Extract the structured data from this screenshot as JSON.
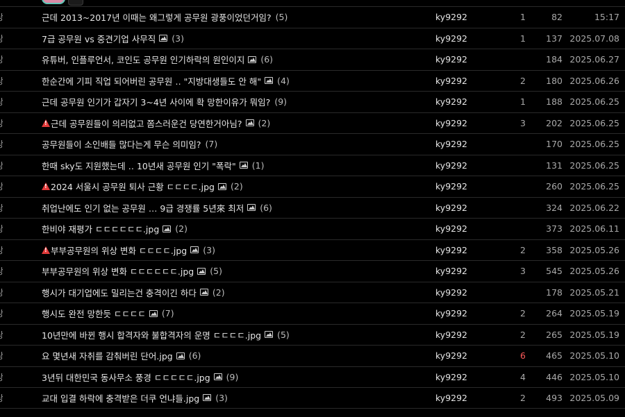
{
  "rows": [
    {
      "lead": "상",
      "title": "근데 2013~2017년 이때는 왜그렇게 공무원 광풍이었던거임?",
      "warn": false,
      "img": false,
      "count": "(5)",
      "author": "ky9292",
      "rec": "1",
      "views": "82",
      "date": "15:17"
    },
    {
      "lead": "상",
      "title": "7급 공무원 vs 중견기업 사무직",
      "warn": false,
      "img": true,
      "count": "(3)",
      "author": "ky9292",
      "rec": "1",
      "views": "137",
      "date": "2025.07.08"
    },
    {
      "lead": "상",
      "title": "유튜버, 인플루언서, 코인도 공무원 인기하락의 원인이지",
      "warn": false,
      "img": true,
      "count": "(6)",
      "author": "ky9292",
      "rec": "",
      "views": "184",
      "date": "2025.06.27"
    },
    {
      "lead": "상",
      "title": "한순간에 기피 직업 되어버린 공무원 ‥ \"지방대생들도 안 해\"",
      "warn": false,
      "img": true,
      "count": "(4)",
      "author": "ky9292",
      "rec": "2",
      "views": "180",
      "date": "2025.06.26"
    },
    {
      "lead": "상",
      "title": "근데 공무원 인기가 갑자기 3~4년 사이에 확 망한이유가 뭐임?",
      "warn": false,
      "img": false,
      "count": "(9)",
      "author": "ky9292",
      "rec": "1",
      "views": "188",
      "date": "2025.06.25"
    },
    {
      "lead": "상",
      "title": "근데 공무원들이 의리없고 쫌스러운건 당연한거아님?",
      "warn": true,
      "img": true,
      "count": "(2)",
      "author": "ky9292",
      "rec": "3",
      "views": "202",
      "date": "2025.06.25"
    },
    {
      "lead": "상",
      "title": "공무원들이 소인배들 많다는게 무슨 의미임?",
      "warn": false,
      "img": false,
      "count": "(7)",
      "author": "ky9292",
      "rec": "",
      "views": "170",
      "date": "2025.06.25"
    },
    {
      "lead": "상",
      "title": "한때 sky도 지원했는데 ‥ 10년새 공무원 인기 \"폭락\"",
      "warn": false,
      "img": true,
      "count": "(1)",
      "author": "ky9292",
      "rec": "",
      "views": "131",
      "date": "2025.06.25"
    },
    {
      "lead": "상",
      "title": "2024 서울시 공무원 퇴사 근황 ㄷㄷㄷㄷ.jpg",
      "warn": true,
      "img": true,
      "count": "(2)",
      "author": "ky9292",
      "rec": "",
      "views": "260",
      "date": "2025.06.25"
    },
    {
      "lead": "상",
      "title": "취업난에도 인기 없는 공무원 … 9급 경쟁률 5년來 최저",
      "warn": false,
      "img": true,
      "count": "(6)",
      "author": "ky9292",
      "rec": "",
      "views": "324",
      "date": "2025.06.22"
    },
    {
      "lead": "상",
      "title": "한비야 재평가 ㄷㄷㄷㄷㄷㄷ.jpg",
      "warn": false,
      "img": true,
      "count": "(2)",
      "author": "ky9292",
      "rec": "",
      "views": "373",
      "date": "2025.06.11"
    },
    {
      "lead": "상",
      "title": "부부공무원의 위상 변화 ㄷㄷㄷㄷ.jpg",
      "warn": true,
      "img": true,
      "count": "(3)",
      "author": "ky9292",
      "rec": "2",
      "views": "358",
      "date": "2025.05.26"
    },
    {
      "lead": "상",
      "title": "부부공무원의 위상 변화 ㄷㄷㄷㄷㄷㄷ.jpg",
      "warn": false,
      "img": true,
      "count": "(5)",
      "author": "ky9292",
      "rec": "3",
      "views": "545",
      "date": "2025.05.26"
    },
    {
      "lead": "상",
      "title": "행시가 대기업에도 밀리는건 충격이긴 하다",
      "warn": false,
      "img": true,
      "count": "(2)",
      "author": "ky9292",
      "rec": "",
      "views": "178",
      "date": "2025.05.21"
    },
    {
      "lead": "상",
      "title": "행시도 완전 망한듯 ㄷㄷㄷㄷ",
      "warn": false,
      "img": true,
      "count": "(7)",
      "author": "ky9292",
      "rec": "2",
      "views": "264",
      "date": "2025.05.19"
    },
    {
      "lead": "상",
      "title": "10년만에 바뀐 행시 합격자와 불합격자의 운명 ㄷㄷㄷㄷ.jpg",
      "warn": false,
      "img": true,
      "count": "(5)",
      "author": "ky9292",
      "rec": "2",
      "views": "265",
      "date": "2025.05.19"
    },
    {
      "lead": "상",
      "title": "요 몇년새 자취를 감춰버린 단어.jpg",
      "warn": false,
      "img": true,
      "count": "(6)",
      "author": "ky9292",
      "rec": "6",
      "recHot": true,
      "views": "465",
      "date": "2025.05.10"
    },
    {
      "lead": "상",
      "title": "3년뒤 대한민국 동사무소 풍경 ㄷㄷㄷㄷㄷ.jpg",
      "warn": false,
      "img": true,
      "count": "(9)",
      "author": "ky9292",
      "rec": "4",
      "views": "446",
      "date": "2025.05.10"
    },
    {
      "lead": "상",
      "title": "교대 입결 하락에 충격받은 더쿠 언냐들.jpg",
      "warn": false,
      "img": true,
      "count": "(3)",
      "author": "ky9292",
      "rec": "2",
      "views": "493",
      "date": "2025.05.09"
    }
  ]
}
